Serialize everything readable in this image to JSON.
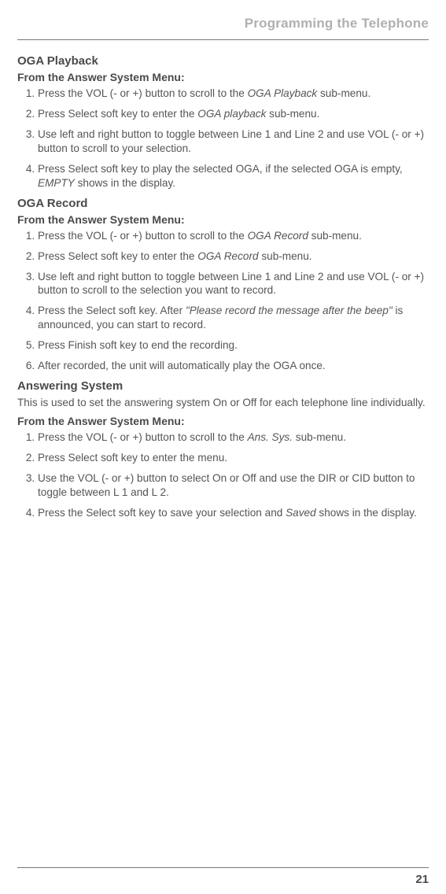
{
  "header": "Programming the Telephone",
  "sections": [
    {
      "title": "OGA Playback",
      "from": "From the Answer System Menu:",
      "items": [
        {
          "pre": "Press the VOL (- or +) button to scroll to the ",
          "it": "OGA Playback",
          "post": " sub-menu."
        },
        {
          "pre": "Press Select soft key to enter the ",
          "it": "OGA playback",
          "post": " sub-menu."
        },
        {
          "pre": "Use left and right button to toggle between Line 1 and Line 2 and use VOL (- or +) button to scroll to your selection.",
          "it": "",
          "post": ""
        },
        {
          "pre": "Press Select soft key to play the selected OGA, if the selected OGA is empty, ",
          "it": "EMPTY",
          "post": " shows in the display."
        }
      ]
    },
    {
      "title": "OGA Record",
      "from": "From the Answer System Menu:",
      "items": [
        {
          "pre": "Press the VOL (- or +) button to scroll to the ",
          "it": "OGA Record",
          "post": " sub-menu."
        },
        {
          "pre": "Press Select soft key to enter the ",
          "it": "OGA Record",
          "post": " sub-menu."
        },
        {
          "pre": "Use left and right button to toggle between Line 1 and Line 2 and use VOL (- or +) button to scroll to the selection you want to record.",
          "it": "",
          "post": ""
        },
        {
          "pre": "Press the Select soft key. After ",
          "it": "\"Please record the message after the beep\"",
          "post": " is announced, you can start to record."
        },
        {
          "pre": "Press Finish soft key to end the recording.",
          "it": "",
          "post": ""
        },
        {
          "pre": "After recorded, the unit will automatically play the OGA once.",
          "it": "",
          "post": ""
        }
      ]
    }
  ],
  "ans": {
    "title": "Answering System",
    "body": "This is used to set the answering system On or Off for each telephone line individually.",
    "from": "From the Answer System Menu:",
    "items": [
      {
        "pre": "Press the VOL (- or +) button to scroll to the ",
        "it": "Ans. Sys.",
        "post": " sub-menu."
      },
      {
        "pre": "Press Select soft key to enter the menu.",
        "it": "",
        "post": ""
      },
      {
        "pre": "Use the VOL (- or +) button to select On or Off and use the DIR or CID button to toggle between L 1 and L 2.",
        "it": "",
        "post": ""
      },
      {
        "pre": "Press the Select soft key to save your selection and ",
        "it": "Saved",
        "post": " shows in the display."
      }
    ]
  },
  "page_number": "21"
}
